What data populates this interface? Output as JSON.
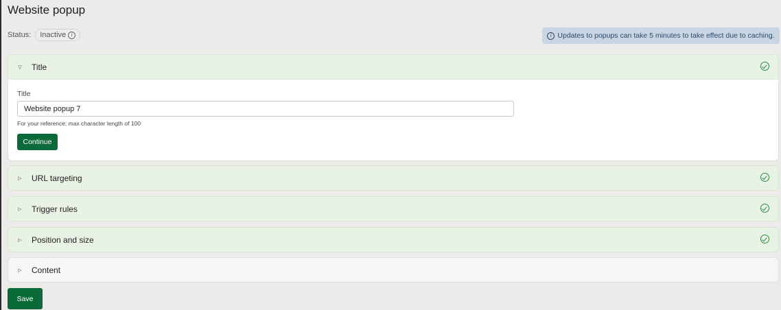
{
  "page": {
    "title": "Website popup",
    "status_label": "Status:",
    "status_value": "Inactive",
    "info_glyph": "ⓘ",
    "notice": "Updates to popups can take 5 minutes to take effect due to caching."
  },
  "sections": {
    "title": {
      "label": "Title",
      "expanded": true,
      "complete": true
    },
    "url_targeting": {
      "label": "URL targeting",
      "complete": true
    },
    "trigger_rules": {
      "label": "Trigger rules",
      "complete": true
    },
    "position_size": {
      "label": "Position and size",
      "complete": true
    },
    "content": {
      "label": "Content",
      "complete": false
    }
  },
  "title_form": {
    "field_label": "Title",
    "value": "Website popup 7",
    "help": "For your reference; max character length of 100",
    "continue_label": "Continue"
  },
  "footer": {
    "save_label": "Save"
  },
  "icons": {
    "expanded": "caret-down-icon",
    "collapsed": "caret-right-icon",
    "complete": "check-circle-icon",
    "info": "info-icon"
  },
  "colors": {
    "primary": "#0b6b38",
    "complete_panel": "#e9f3e5",
    "check": "#2d8a3e",
    "notice_bg": "#c9d5e2"
  }
}
